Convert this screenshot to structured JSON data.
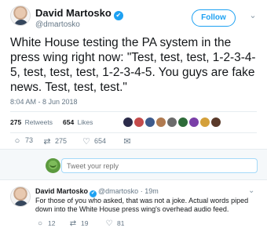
{
  "tweet": {
    "author_name": "David Martosko",
    "handle": "@dmartosko",
    "follow_label": "Follow",
    "text": "White House testing the PA system in the press wing right now: \"Test, test, test, 1-2-3-4-5, test, test, test, 1-2-3-4-5. You guys are fake news. Test, test, test.\"",
    "timestamp": "8:04 AM - 8 Jun 2018",
    "retweets_count": "275",
    "retweets_label": "Retweets",
    "likes_count": "654",
    "likes_label": "Likes",
    "liker_colors": [
      "#2b2b4a",
      "#c44b4b",
      "#3d5a8c",
      "#b07a4f",
      "#6b6b6b",
      "#2e6b3a",
      "#7a3fa8",
      "#d4a03a",
      "#5a3a2a"
    ],
    "actions": {
      "reply_count": "73",
      "retweet_count": "275",
      "like_count": "654"
    },
    "reply_placeholder": "Tweet your reply"
  },
  "reply": {
    "author_name": "David Martosko",
    "handle": "@dmartosko",
    "time": "· 19m",
    "text": "For those of you who asked, that was not a joke. Actual words piped down into the White House press wing's overhead audio feed.",
    "reply_count": "12",
    "retweet_count": "19",
    "like_count": "81"
  },
  "icons": {
    "verified": "✔",
    "chevron": "⌄",
    "reply": "○",
    "retweet": "⇄",
    "like": "♡",
    "mail": "✉"
  }
}
